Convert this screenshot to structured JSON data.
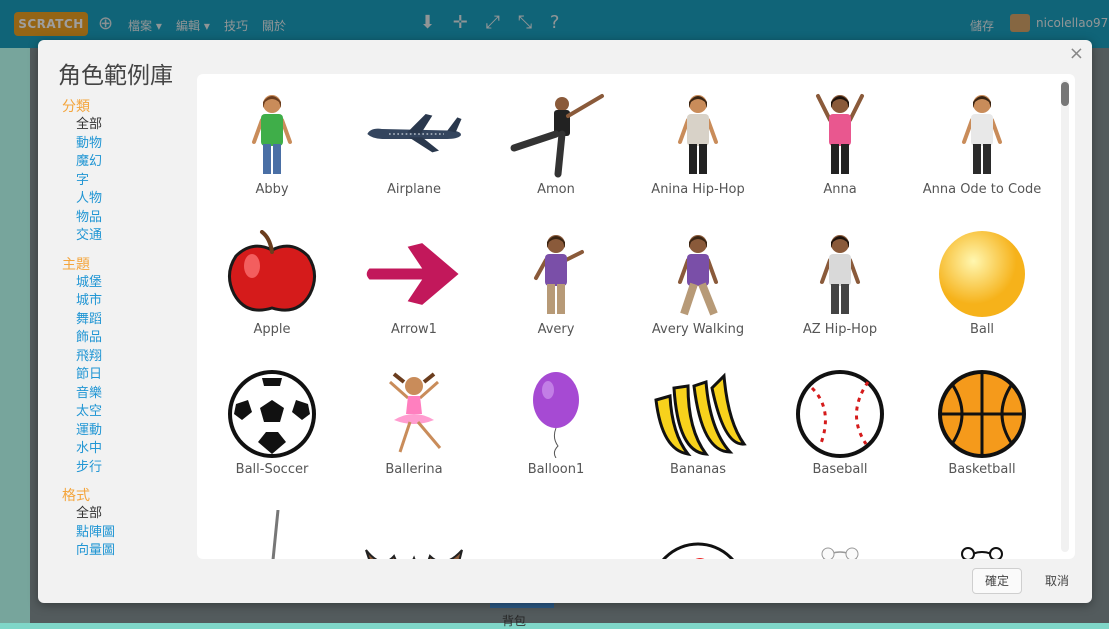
{
  "topbar": {
    "logo": "SCRATCH",
    "menus": [
      "檔案 ▾",
      "編輯 ▾",
      "技巧",
      "關於"
    ],
    "tools": "⬇ ✛ ⤢ ⤡ ?",
    "save": "儲存",
    "username": "nicolellao97"
  },
  "modal": {
    "title": "角色範例庫",
    "close": "×",
    "ok_label": "確定",
    "cancel_label": "取消"
  },
  "sidebar": {
    "category_heading": "分類",
    "categories": [
      "全部",
      "動物",
      "魔幻",
      "字",
      "人物",
      "物品",
      "交通"
    ],
    "theme_heading": "主題",
    "themes": [
      "城堡",
      "城市",
      "舞蹈",
      "飾品",
      "飛翔",
      "節日",
      "音樂",
      "太空",
      "運動",
      "水中",
      "步行"
    ],
    "format_heading": "格式",
    "formats": [
      "全部",
      "點陣圖",
      "向量圖"
    ]
  },
  "sprites": [
    {
      "name": "Abby",
      "icon": "girl-green-shirt"
    },
    {
      "name": "Airplane",
      "icon": "airplane"
    },
    {
      "name": "Amon",
      "icon": "dancer-kick"
    },
    {
      "name": "Anina Hip-Hop",
      "icon": "dancer-girl"
    },
    {
      "name": "Anna",
      "icon": "girl-arms-up"
    },
    {
      "name": "Anna Ode to Code",
      "icon": "girl-standing"
    },
    {
      "name": "Apple",
      "icon": "red-apple"
    },
    {
      "name": "Arrow1",
      "icon": "pink-arrow"
    },
    {
      "name": "Avery",
      "icon": "girl-purple-shirt"
    },
    {
      "name": "Avery Walking",
      "icon": "girl-walking"
    },
    {
      "name": "AZ Hip-Hop",
      "icon": "boy-standing"
    },
    {
      "name": "Ball",
      "icon": "yellow-ball"
    },
    {
      "name": "Ball-Soccer",
      "icon": "soccer-ball"
    },
    {
      "name": "Ballerina",
      "icon": "ballerina"
    },
    {
      "name": "Balloon1",
      "icon": "purple-balloon"
    },
    {
      "name": "Bananas",
      "icon": "bananas"
    },
    {
      "name": "Baseball",
      "icon": "baseball"
    },
    {
      "name": "Basketball",
      "icon": "basketball"
    },
    {
      "name": "",
      "icon": "bat-bat"
    },
    {
      "name": "",
      "icon": "bat-wing"
    },
    {
      "name": "",
      "icon": "black-bat"
    },
    {
      "name": "",
      "icon": "beachball"
    },
    {
      "name": "",
      "icon": "bear-scarf"
    },
    {
      "name": "",
      "icon": "polar-bear"
    }
  ],
  "background": {
    "bottom_label": "背包"
  },
  "colors": {
    "accent_orange": "#f4a53c",
    "link_blue": "#2196d4",
    "apple_red": "#d51b1b",
    "arrow_pink": "#c2185b"
  }
}
